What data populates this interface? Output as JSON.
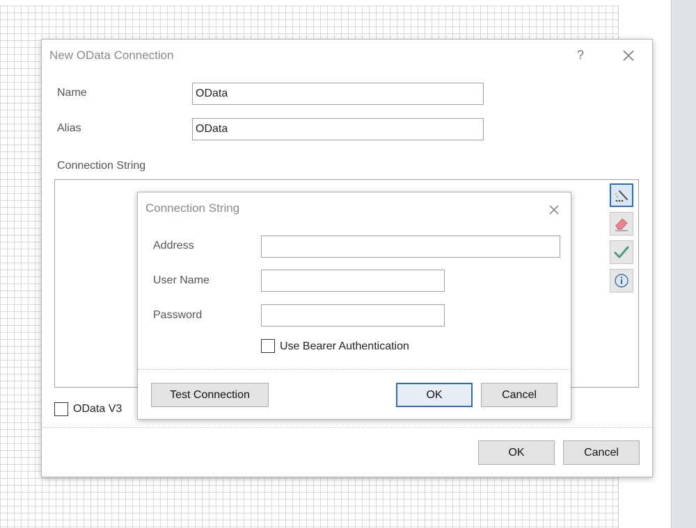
{
  "main_dialog": {
    "title": "New OData Connection",
    "help_glyph": "?",
    "close_glyph": "✕",
    "name_label": "Name",
    "name_value": "OData",
    "alias_label": "Alias",
    "alias_value": "OData",
    "connection_string_label": "Connection String",
    "connection_string_value": "",
    "odata_v3_label": "OData V3",
    "odata_v3_checked": false,
    "ok_label": "OK",
    "cancel_label": "Cancel"
  },
  "toolbar_icons": [
    "wizard-wand-icon",
    "eraser-icon",
    "checkmark-icon",
    "info-icon"
  ],
  "colors": {
    "accent_blue": "#2d6fb7",
    "eraser_pink": "#e8848f",
    "check_green": "#4f9a83"
  },
  "connection_string_dialog": {
    "title": "Connection String",
    "close_glyph": "✕",
    "address_label": "Address",
    "address_value": "",
    "username_label": "User Name",
    "username_value": "",
    "password_label": "Password",
    "password_value": "",
    "bearer_label": "Use Bearer Authentication",
    "bearer_checked": false,
    "test_connection_label": "Test Connection",
    "ok_label": "OK",
    "cancel_label": "Cancel"
  }
}
